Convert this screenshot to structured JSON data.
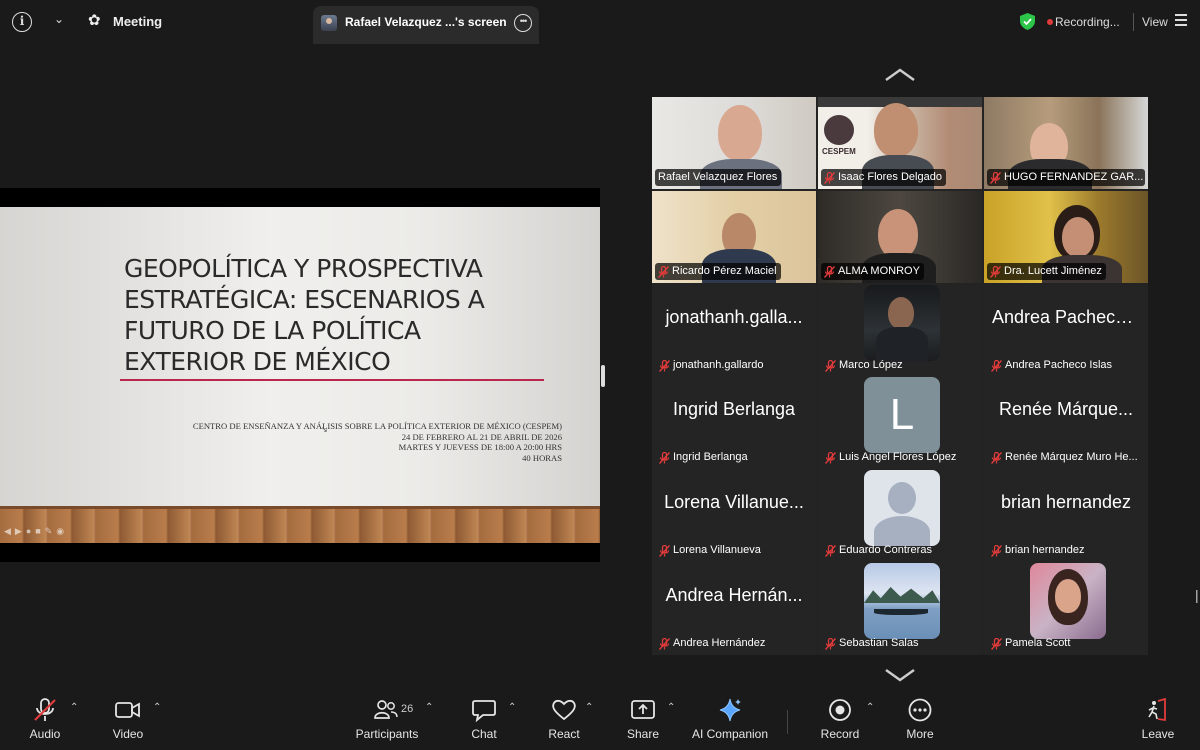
{
  "topbar": {
    "meeting_label": "Meeting",
    "share_tab_title": "Rafael Velazquez ...'s screen",
    "recording_label": "Recording...",
    "view_label": "View"
  },
  "slide": {
    "title": "GEOPOLÍTICA Y PROSPECTIVA\nESTRATÉGICA: ESCENARIOS A\nFUTURO DE LA POLÍTICA\nEXTERIOR DE MÉXICO",
    "info": "CENTRO DE ENSEÑANZA Y ANÁLISIS SOBRE LA POLÍTICA EXTERIOR DE MÉXICO (CESPEM)\n24 DE FEBRERO  AL 21 DE ABRIL DE 2026\nMARTES  Y  JUEVESS DE 18:00 A 20:00 HRS\n40 HORAS"
  },
  "participants": [
    {
      "name": "Rafael Velazquez Flores",
      "muted": false,
      "active": true
    },
    {
      "name": "Isaac Flores Delgado",
      "muted": true,
      "logo_text": "CESPEM"
    },
    {
      "name": "HUGO FERNANDEZ GAR...",
      "muted": true
    },
    {
      "name": "Ricardo Pérez Maciel",
      "muted": true
    },
    {
      "name": "ALMA MONROY",
      "muted": true
    },
    {
      "name": "Dra. Lucett Jiménez",
      "muted": true
    },
    {
      "name": "jonathanh.gallardo",
      "display": "jonathanh.galla...",
      "muted": true
    },
    {
      "name": "Marco López",
      "muted": true
    },
    {
      "name": "Andrea Pacheco Islas",
      "display": "Andrea Pacheco...",
      "muted": true
    },
    {
      "name": "Ingrid Berlanga",
      "display": "Ingrid Berlanga",
      "muted": true
    },
    {
      "name": "Luis Angel Flores López",
      "avatar_letter": "L",
      "muted": true
    },
    {
      "name": "Renée Márquez Muro He...",
      "display": "Renée Márque...",
      "muted": true
    },
    {
      "name": "Lorena Villanueva",
      "display": "Lorena Villanue...",
      "muted": true
    },
    {
      "name": "Eduardo Contreras",
      "muted": true
    },
    {
      "name": "brian hernandez",
      "display": "brian hernandez",
      "muted": true
    },
    {
      "name": "Andrea Hernández",
      "display": "Andrea Hernán...",
      "muted": true
    },
    {
      "name": "Sebastian Salas",
      "muted": true
    },
    {
      "name": "Pamela Scott",
      "muted": true
    }
  ],
  "toolbar": {
    "audio": "Audio",
    "video": "Video",
    "participants": "Participants",
    "participants_count": "26",
    "chat": "Chat",
    "react": "React",
    "share": "Share",
    "ai_companion": "AI Companion",
    "record": "Record",
    "more": "More",
    "leave": "Leave"
  },
  "colors": {
    "accent_green": "#2dc44a",
    "recording_red": "#e03a3a",
    "mute_red": "#e23b3b",
    "slide_line": "#b8284e"
  }
}
